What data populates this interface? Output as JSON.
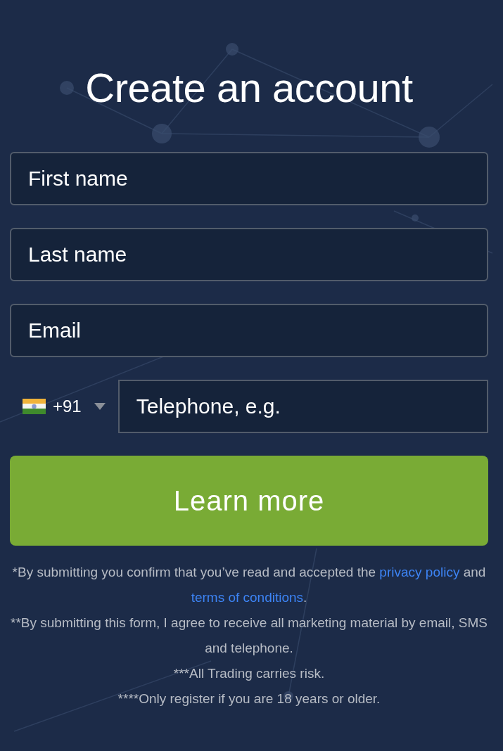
{
  "title": "Create an account",
  "fields": [
    {
      "placeholder": "First name"
    },
    {
      "placeholder": "Last name"
    },
    {
      "placeholder": "Email"
    }
  ],
  "phone": {
    "country_code": "+91",
    "placeholder": "Telephone, e.g."
  },
  "submit_button": "Learn more",
  "notes": [
    {
      "parts": [
        {
          "kind": "text",
          "text": "*By submitting you confirm that you’ve read and accepted the "
        },
        {
          "kind": "link",
          "text": "privacy policy"
        },
        {
          "kind": "text",
          "text": " and "
        },
        {
          "kind": "link",
          "text": "terms of conditions"
        },
        {
          "kind": "text",
          "text": "."
        }
      ]
    },
    {
      "parts": [
        {
          "kind": "text",
          "text": "**By submitting this form, I agree to receive all marketing material by email, SMS and telephone."
        }
      ]
    },
    {
      "parts": [
        {
          "kind": "text",
          "text": "***All Trading carries risk."
        }
      ]
    },
    {
      "parts": [
        {
          "kind": "text",
          "text": "****Only register if you are 18 years or older."
        }
      ]
    }
  ]
}
